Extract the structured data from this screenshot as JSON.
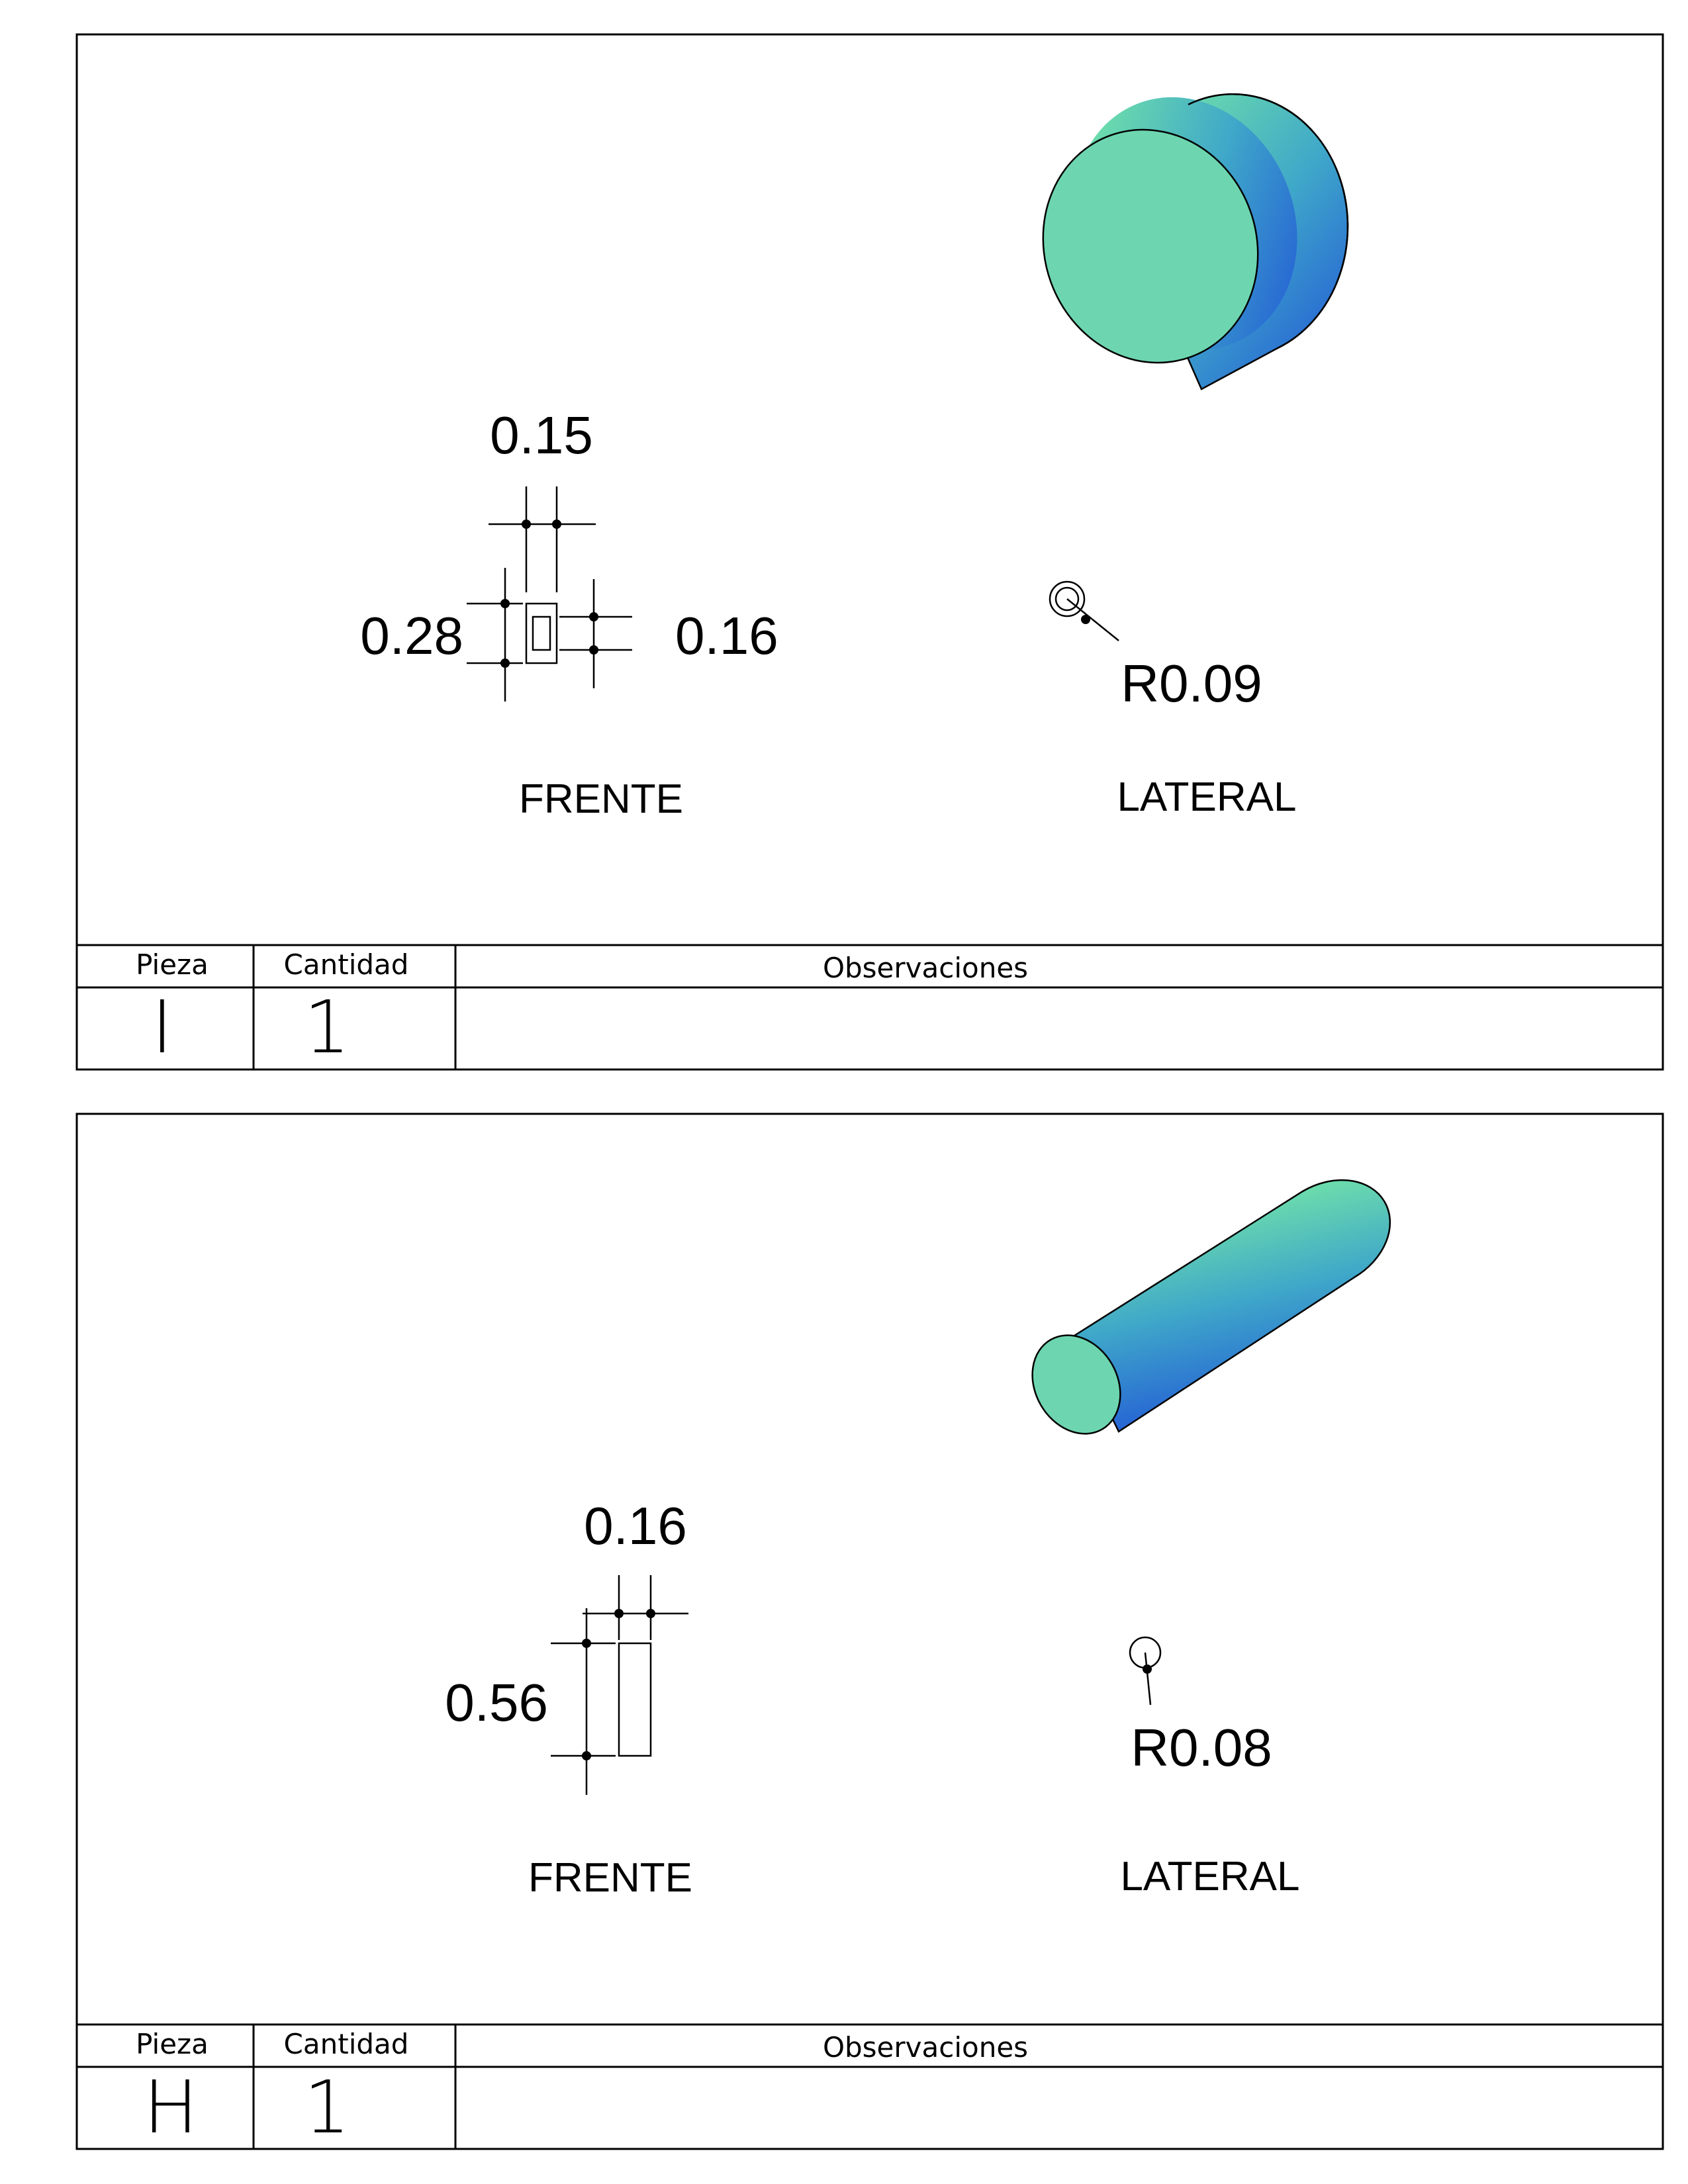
{
  "sheets": [
    {
      "id": "I",
      "front": {
        "width_top": "0.15",
        "height_left": "0.28",
        "height_right": "0.16",
        "label": "FRENTE"
      },
      "side": {
        "radius": "R0.09",
        "label": "LATERAL"
      },
      "table": {
        "headers": [
          "Pieza",
          "Cantidad",
          "Observaciones"
        ],
        "pieza": "I",
        "cantidad": "1",
        "observaciones": ""
      },
      "iso_shape": "short-cylinder"
    },
    {
      "id": "H",
      "front": {
        "width_top": "0.16",
        "height_left": "0.56",
        "label": "FRENTE"
      },
      "side": {
        "radius": "R0.08",
        "label": "LATERAL"
      },
      "table": {
        "headers": [
          "Pieza",
          "Cantidad",
          "Observaciones"
        ],
        "pieza": "H",
        "cantidad": "1",
        "observaciones": ""
      },
      "iso_shape": "long-cylinder"
    }
  ],
  "colors": {
    "cyl_light": "#6dd6b0",
    "cyl_top": "#7ef2a0",
    "cyl_dark": "#1e4fd8",
    "line": "#000000"
  }
}
